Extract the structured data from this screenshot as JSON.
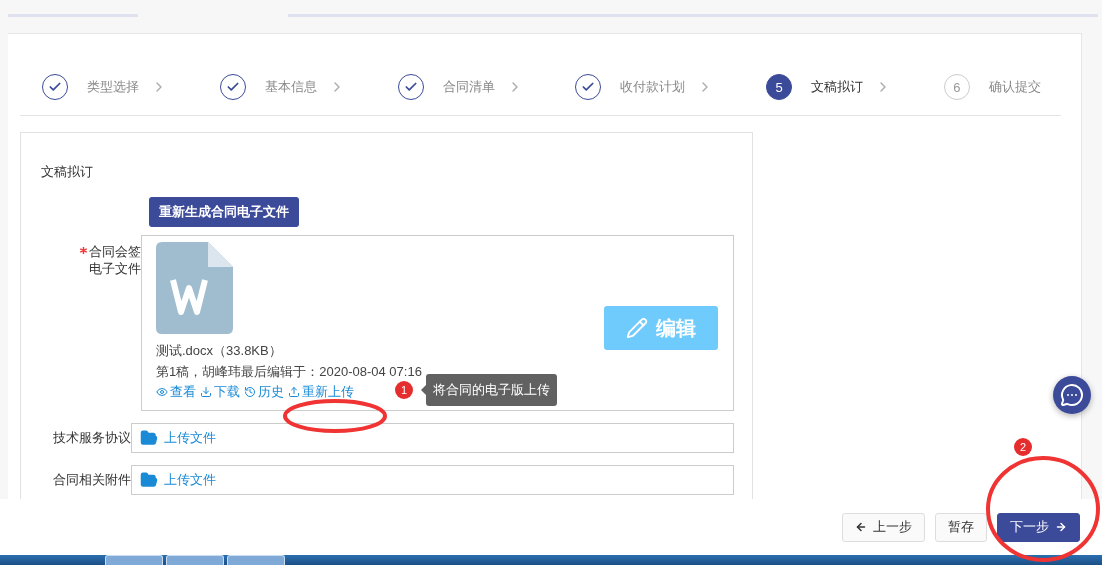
{
  "steps": [
    {
      "kind": "done",
      "label": "类型选择"
    },
    {
      "kind": "done",
      "label": "基本信息"
    },
    {
      "kind": "done",
      "label": "合同清单"
    },
    {
      "kind": "done",
      "label": "收付款计划"
    },
    {
      "kind": "active",
      "number": "5",
      "label": "文稿拟订"
    },
    {
      "kind": "pending",
      "number": "6",
      "label": "确认提交"
    }
  ],
  "section_title": "文稿拟订",
  "regenerate_button": "重新生成合同电子文件",
  "signed_file": {
    "label": "合同会签电子文件",
    "required": true,
    "file_name": "测试.docx（33.8KB）",
    "meta": "第1稿，胡峰玮最后编辑于：2020-08-04 07:16",
    "actions": [
      {
        "kind": "view",
        "label": "查看"
      },
      {
        "kind": "download",
        "label": "下载"
      },
      {
        "kind": "history",
        "label": "历史"
      },
      {
        "kind": "upload",
        "label": "重新上传"
      }
    ],
    "edit_button": "编辑"
  },
  "tooltip": {
    "badge": "1",
    "text": "将合同的电子版上传"
  },
  "uploads": [
    {
      "label": "技术服务协议",
      "button": "上传文件"
    },
    {
      "label": "合同相关附件",
      "button": "上传文件"
    }
  ],
  "footer": {
    "badge": "2",
    "buttons": [
      {
        "kind": "prev",
        "label": "上一步"
      },
      {
        "kind": "save",
        "label": "暂存"
      },
      {
        "kind": "next",
        "label": "下一步"
      }
    ]
  }
}
